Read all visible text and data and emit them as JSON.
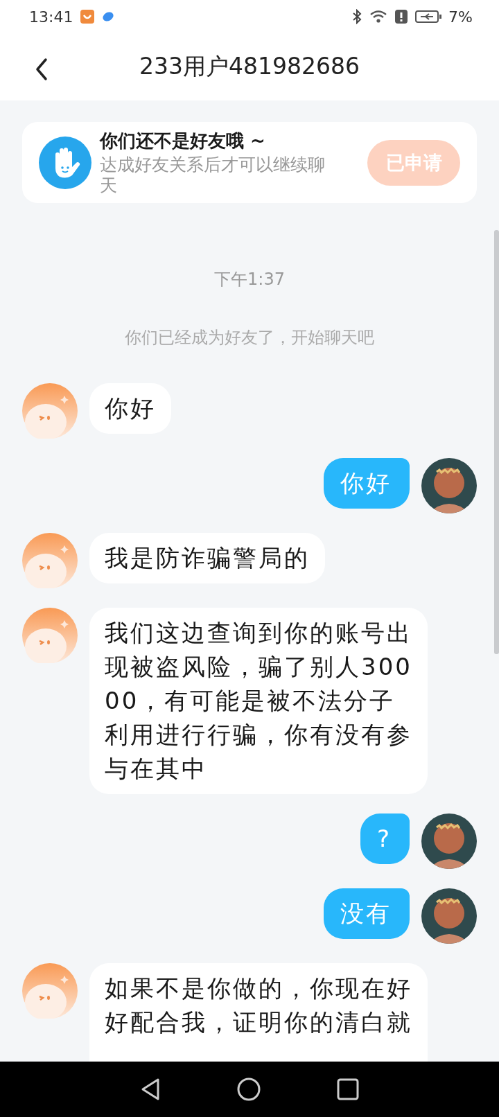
{
  "status_bar": {
    "time": "13:41",
    "battery": "7%"
  },
  "header": {
    "title": "233用户481982686"
  },
  "friend_notice": {
    "title": "你们还不是好友哦 ~",
    "subtitle": "达成好友关系后才可以继续聊天",
    "button": {
      "label": "已申请",
      "disabled": true
    }
  },
  "chat": {
    "timestamp": "下午1:37",
    "system_message": "你们已经成为好友了，开始聊天吧",
    "messages": [
      {
        "kind": "received",
        "text": "你好"
      },
      {
        "kind": "sent",
        "text": "你好"
      },
      {
        "kind": "received",
        "text": "我是防诈骗警局的"
      },
      {
        "kind": "received",
        "text": "我们这边查询到你的账号出现被盗风险，骗了别人30000，有可能是被不法分子利用进行行骗，你有没有参与在其中"
      },
      {
        "kind": "sent",
        "text": "?"
      },
      {
        "kind": "sent",
        "text": "没有"
      },
      {
        "kind": "received",
        "text": "如果不是你做的，你现在好好配合我，证明你的清白就"
      }
    ]
  }
}
